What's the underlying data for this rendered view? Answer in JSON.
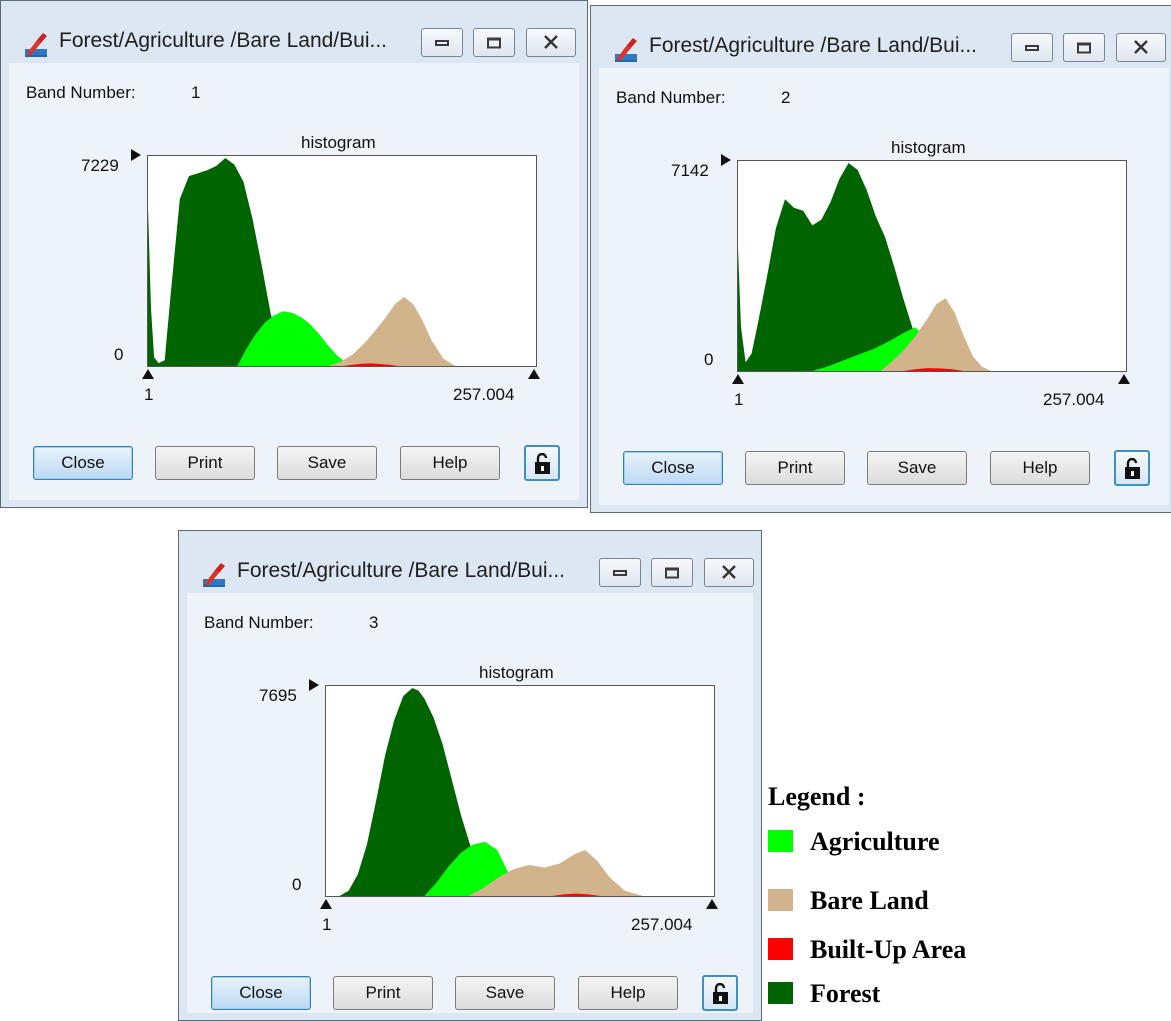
{
  "windows": [
    {
      "title": "Forest/Agriculture /Bare Land/Bui...",
      "band_label": "Band Number:",
      "band_number": "1",
      "histogram_title": "histogram",
      "y_max": "7229",
      "y_min": "0",
      "x_min": "1",
      "x_max": "257.004",
      "buttons": {
        "close": "Close",
        "print": "Print",
        "save": "Save",
        "help": "Help"
      }
    },
    {
      "title": "Forest/Agriculture /Bare Land/Bui...",
      "band_label": "Band Number:",
      "band_number": "2",
      "histogram_title": "histogram",
      "y_max": "7142",
      "y_min": "0",
      "x_min": "1",
      "x_max": "257.004",
      "buttons": {
        "close": "Close",
        "print": "Print",
        "save": "Save",
        "help": "Help"
      }
    },
    {
      "title": "Forest/Agriculture /Bare Land/Bui...",
      "band_label": "Band Number:",
      "band_number": "3",
      "histogram_title": "histogram",
      "y_max": "7695",
      "y_min": "0",
      "x_min": "1",
      "x_max": "257.004",
      "buttons": {
        "close": "Close",
        "print": "Print",
        "save": "Save",
        "help": "Help"
      }
    }
  ],
  "legend": {
    "title": "Legend :",
    "items": [
      {
        "label": "Agriculture",
        "color": "#00ff00"
      },
      {
        "label": "Bare Land",
        "color": "#d2b48c"
      },
      {
        "label": "Built-Up Area",
        "color": "#ff0000"
      },
      {
        "label": "Forest",
        "color": "#006400"
      }
    ]
  },
  "chart_data": [
    {
      "type": "area",
      "title": "histogram",
      "xlim": [
        1,
        257.004
      ],
      "ylim": [
        0,
        7229
      ],
      "series": [
        {
          "name": "Forest",
          "color": "#006400",
          "x": [
            1,
            3,
            5,
            8,
            12,
            16,
            22,
            28,
            34,
            40,
            46,
            52,
            58,
            64,
            70,
            76,
            82,
            88,
            94,
            100
          ],
          "y": [
            5500,
            2000,
            300,
            100,
            200,
            2500,
            5800,
            6600,
            6700,
            6800,
            6950,
            7229,
            7000,
            6400,
            5100,
            3500,
            1800,
            800,
            200,
            0
          ]
        },
        {
          "name": "Agriculture",
          "color": "#00ff00",
          "x": [
            60,
            66,
            72,
            78,
            84,
            90,
            96,
            102,
            108,
            114,
            120,
            126,
            132,
            138
          ],
          "y": [
            0,
            600,
            1100,
            1500,
            1750,
            1900,
            1850,
            1700,
            1450,
            1100,
            700,
            350,
            100,
            0
          ]
        },
        {
          "name": "Bare Land",
          "color": "#d2b48c",
          "x": [
            120,
            128,
            136,
            144,
            152,
            158,
            164,
            170,
            176,
            182,
            188,
            196,
            204
          ],
          "y": [
            0,
            150,
            400,
            800,
            1300,
            1700,
            2150,
            2400,
            2150,
            1600,
            900,
            250,
            0
          ]
        },
        {
          "name": "Built-Up Area",
          "color": "#ff0000",
          "x": [
            130,
            136,
            142,
            148,
            154,
            160,
            166
          ],
          "y": [
            0,
            40,
            80,
            90,
            70,
            40,
            0
          ]
        }
      ]
    },
    {
      "type": "area",
      "title": "histogram",
      "xlim": [
        1,
        257.004
      ],
      "ylim": [
        0,
        7142
      ],
      "series": [
        {
          "name": "Forest",
          "color": "#006400",
          "x": [
            1,
            3,
            6,
            10,
            14,
            20,
            26,
            32,
            38,
            44,
            50,
            56,
            62,
            68,
            74,
            80,
            86,
            92,
            98,
            104,
            110,
            116,
            120,
            126,
            132
          ],
          "y": [
            4200,
            1500,
            300,
            600,
            1600,
            3200,
            4900,
            5900,
            5600,
            5500,
            5000,
            5200,
            5800,
            6600,
            7142,
            6900,
            6200,
            5300,
            4600,
            3600,
            2500,
            1500,
            800,
            200,
            0
          ]
        },
        {
          "name": "Agriculture",
          "color": "#00ff00",
          "x": [
            50,
            60,
            70,
            80,
            90,
            100,
            110,
            118,
            124,
            130
          ],
          "y": [
            0,
            150,
            350,
            550,
            750,
            1000,
            1300,
            1500,
            1200,
            0
          ]
        },
        {
          "name": "Bare Land",
          "color": "#d2b48c",
          "x": [
            95,
            102,
            110,
            118,
            126,
            132,
            138,
            144,
            150,
            156,
            162,
            168
          ],
          "y": [
            0,
            300,
            700,
            1200,
            1800,
            2300,
            2500,
            2000,
            1200,
            500,
            150,
            0
          ]
        },
        {
          "name": "Built-Up Area",
          "color": "#ff0000",
          "x": [
            110,
            118,
            126,
            134,
            142,
            150
          ],
          "y": [
            0,
            60,
            100,
            90,
            60,
            0
          ]
        }
      ]
    },
    {
      "type": "area",
      "title": "histogram",
      "xlim": [
        1,
        257.004
      ],
      "ylim": [
        0,
        7695
      ],
      "series": [
        {
          "name": "Forest",
          "color": "#006400",
          "x": [
            10,
            16,
            22,
            28,
            34,
            40,
            46,
            52,
            58,
            62,
            66,
            72,
            78,
            84,
            90,
            96,
            102,
            108,
            114,
            120,
            126
          ],
          "y": [
            0,
            200,
            800,
            1900,
            3500,
            5200,
            6500,
            7400,
            7695,
            7600,
            7300,
            6600,
            5600,
            4300,
            3000,
            1900,
            1100,
            500,
            150,
            30,
            0
          ]
        },
        {
          "name": "Agriculture",
          "color": "#00ff00",
          "x": [
            66,
            74,
            82,
            90,
            98,
            106,
            114,
            120,
            126,
            130
          ],
          "y": [
            0,
            500,
            1100,
            1600,
            1900,
            2000,
            1700,
            1000,
            400,
            0
          ]
        },
        {
          "name": "Bare Land",
          "color": "#d2b48c",
          "x": [
            95,
            105,
            115,
            125,
            135,
            145,
            155,
            165,
            172,
            180,
            188,
            198,
            210
          ],
          "y": [
            0,
            300,
            700,
            1000,
            1150,
            1050,
            1200,
            1550,
            1700,
            1300,
            700,
            200,
            0
          ]
        },
        {
          "name": "Built-Up Area",
          "color": "#ff0000",
          "x": [
            150,
            158,
            166,
            174,
            182
          ],
          "y": [
            0,
            60,
            90,
            60,
            0
          ]
        }
      ]
    }
  ]
}
